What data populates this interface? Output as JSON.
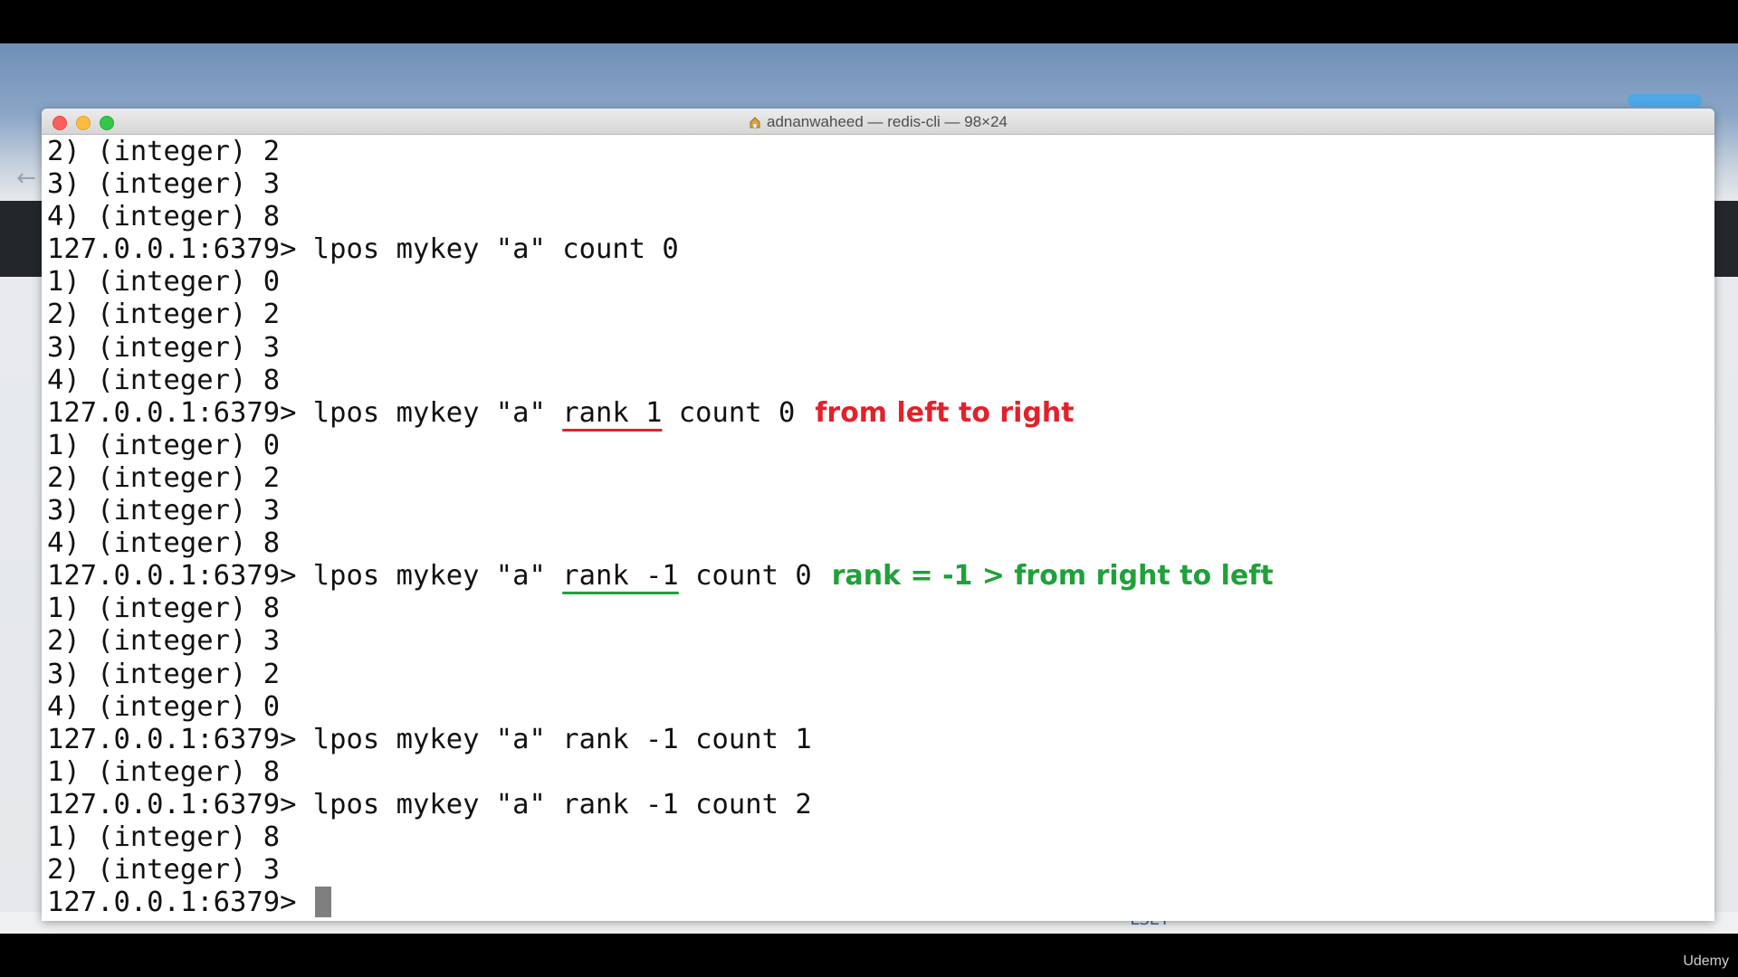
{
  "window": {
    "title": "adnanwaheed — redis-cli — 98×24"
  },
  "terminal": {
    "prompt": "127.0.0.1:6379>",
    "lines": [
      {
        "type": "output",
        "text": "2) (integer) 2"
      },
      {
        "type": "output",
        "text": "3) (integer) 3"
      },
      {
        "type": "output",
        "text": "4) (integer) 8"
      },
      {
        "type": "command",
        "prefix": "127.0.0.1:6379> lpos mykey \"a\" count 0",
        "underlined": "",
        "suffix": ""
      },
      {
        "type": "output",
        "text": "1) (integer) 0"
      },
      {
        "type": "output",
        "text": "2) (integer) 2"
      },
      {
        "type": "output",
        "text": "3) (integer) 3"
      },
      {
        "type": "output",
        "text": "4) (integer) 8"
      },
      {
        "type": "command",
        "prefix": "127.0.0.1:6379> lpos mykey \"a\" ",
        "underlined": "rank 1",
        "suffix": " count 0",
        "annotation": "from left to right",
        "annotation_color": "red"
      },
      {
        "type": "output",
        "text": "1) (integer) 0"
      },
      {
        "type": "output",
        "text": "2) (integer) 2"
      },
      {
        "type": "output",
        "text": "3) (integer) 3"
      },
      {
        "type": "output",
        "text": "4) (integer) 8"
      },
      {
        "type": "command",
        "prefix": "127.0.0.1:6379> lpos mykey \"a\" ",
        "underlined": "rank -1",
        "suffix": " count 0",
        "annotation": "rank = -1 > from right to left",
        "annotation_color": "green"
      },
      {
        "type": "output",
        "text": "1) (integer) 8"
      },
      {
        "type": "output",
        "text": "2) (integer) 3"
      },
      {
        "type": "output",
        "text": "3) (integer) 2"
      },
      {
        "type": "output",
        "text": "4) (integer) 0"
      },
      {
        "type": "command",
        "prefix": "127.0.0.1:6379> lpos mykey \"a\" rank -1 count 1",
        "underlined": "",
        "suffix": ""
      },
      {
        "type": "output",
        "text": "1) (integer) 8"
      },
      {
        "type": "command",
        "prefix": "127.0.0.1:6379> lpos mykey \"a\" rank -1 count 2",
        "underlined": "",
        "suffix": ""
      },
      {
        "type": "output",
        "text": "1) (integer) 8"
      },
      {
        "type": "output",
        "text": "2) (integer) 3"
      }
    ],
    "current_prompt": "127.0.0.1:6379> "
  },
  "colors": {
    "annotation_red": "#e2212a",
    "annotation_green": "#1fa13a",
    "close": "#fc605c",
    "minimize": "#fdbc40",
    "maximize": "#34c84a"
  },
  "icons": [
    "home-icon",
    "back-arrow-icon"
  ],
  "watermark": "Udemy"
}
